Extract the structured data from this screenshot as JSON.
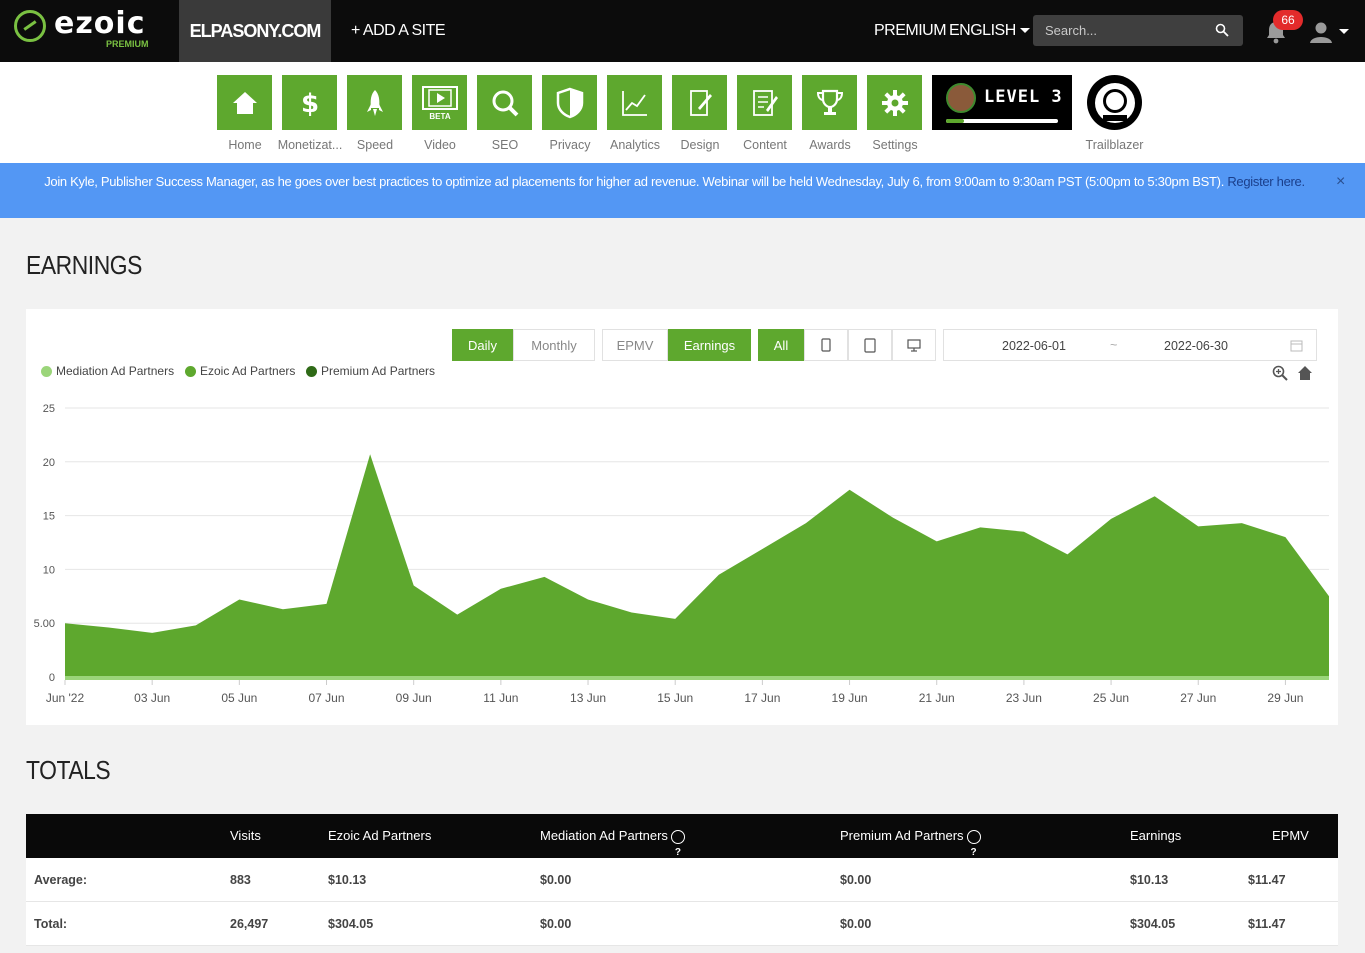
{
  "header": {
    "logo_text": "ezoic",
    "logo_sub": "PREMIUM",
    "site_name": "ELPASONY.COM",
    "add_site": "+ ADD A SITE",
    "premium": "PREMIUM",
    "language": "ENGLISH",
    "search_placeholder": "Search...",
    "notification_count": "66"
  },
  "nav": {
    "items": [
      {
        "label": "Home",
        "icon": "home-icon"
      },
      {
        "label": "Monetizat...",
        "icon": "dollar-icon"
      },
      {
        "label": "Speed",
        "icon": "rocket-icon"
      },
      {
        "label": "Video",
        "icon": "video-icon",
        "tag": "BETA"
      },
      {
        "label": "SEO",
        "icon": "magnifier-icon"
      },
      {
        "label": "Privacy",
        "icon": "shield-icon"
      },
      {
        "label": "Analytics",
        "icon": "line-chart-icon"
      },
      {
        "label": "Design",
        "icon": "design-icon"
      },
      {
        "label": "Content",
        "icon": "content-icon"
      },
      {
        "label": "Awards",
        "icon": "trophy-icon"
      },
      {
        "label": "Settings",
        "icon": "gear-icon"
      }
    ],
    "level_text": "LEVEL 3",
    "level_progress": 0.16,
    "trailblazer_label": "Trailblazer"
  },
  "announcement": {
    "text": "Join Kyle, Publisher Success Manager, as he goes over best practices to optimize ad placements for higher ad revenue. Webinar will be held Wednesday, July 6, from 9:00am to 9:30am PST (5:00pm to 5:30pm BST).",
    "link_text": "Register here.",
    "close": "×"
  },
  "earnings": {
    "title": "EARNINGS",
    "buttons": {
      "daily": "Daily",
      "monthly": "Monthly",
      "epmv": "EPMV",
      "earnings": "Earnings",
      "all": "All"
    },
    "date_start": "2022-06-01",
    "date_sep": "~",
    "date_end": "2022-06-30",
    "legend": [
      {
        "name": "Mediation Ad Partners",
        "color": "#9bd57a"
      },
      {
        "name": "Ezoic Ad Partners",
        "color": "#5ea82e"
      },
      {
        "name": "Premium Ad Partners",
        "color": "#2f6a17"
      }
    ]
  },
  "chart_data": {
    "type": "area",
    "x": [
      "2022-06-01",
      "2022-06-02",
      "2022-06-03",
      "2022-06-04",
      "2022-06-05",
      "2022-06-06",
      "2022-06-07",
      "2022-06-08",
      "2022-06-09",
      "2022-06-10",
      "2022-06-11",
      "2022-06-12",
      "2022-06-13",
      "2022-06-14",
      "2022-06-15",
      "2022-06-16",
      "2022-06-17",
      "2022-06-18",
      "2022-06-19",
      "2022-06-20",
      "2022-06-21",
      "2022-06-22",
      "2022-06-23",
      "2022-06-24",
      "2022-06-25",
      "2022-06-26",
      "2022-06-27",
      "2022-06-28",
      "2022-06-29",
      "2022-06-30"
    ],
    "x_tick_labels": [
      "Jun '22",
      "03 Jun",
      "05 Jun",
      "07 Jun",
      "09 Jun",
      "11 Jun",
      "13 Jun",
      "15 Jun",
      "17 Jun",
      "19 Jun",
      "21 Jun",
      "23 Jun",
      "25 Jun",
      "27 Jun",
      "29 Jun"
    ],
    "series": [
      {
        "name": "Ezoic Ad Partners",
        "color": "#5ea82e",
        "values": [
          5.0,
          4.6,
          4.1,
          4.8,
          7.2,
          6.3,
          6.8,
          20.7,
          8.5,
          5.8,
          8.2,
          9.3,
          7.2,
          6.0,
          5.4,
          9.5,
          11.9,
          14.3,
          17.4,
          14.8,
          12.6,
          13.9,
          13.5,
          11.4,
          14.7,
          16.8,
          14.0,
          14.3,
          13.0,
          7.5
        ]
      },
      {
        "name": "Mediation Ad Partners",
        "color": "#9bd57a",
        "values": [
          0,
          0,
          0,
          0,
          0,
          0,
          0,
          0,
          0,
          0,
          0,
          0,
          0,
          0,
          0,
          0,
          0,
          0,
          0,
          0,
          0,
          0,
          0,
          0,
          0,
          0,
          0,
          0,
          0,
          0
        ]
      },
      {
        "name": "Premium Ad Partners",
        "color": "#2f6a17",
        "values": [
          0,
          0,
          0,
          0,
          0,
          0,
          0,
          0,
          0,
          0,
          0,
          0,
          0,
          0,
          0,
          0,
          0,
          0,
          0,
          0,
          0,
          0,
          0,
          0,
          0,
          0,
          0,
          0,
          0,
          0
        ]
      }
    ],
    "y_tick_labels": [
      "0",
      "5.00",
      "10",
      "15",
      "20",
      "25"
    ],
    "ylim": [
      0,
      25
    ],
    "grid": true,
    "legend_position": "top-left"
  },
  "totals": {
    "title": "TOTALS",
    "headers": [
      "",
      "Visits",
      "Ezoic Ad Partners",
      "Mediation Ad Partners",
      "Premium Ad Partners",
      "Earnings",
      "EPMV"
    ],
    "rows": [
      [
        "Average:",
        "883",
        "$10.13",
        "$0.00",
        "$0.00",
        "$10.13",
        "$11.47"
      ],
      [
        "Total:",
        "26,497",
        "$304.05",
        "$0.00",
        "$0.00",
        "$304.05",
        "$11.47"
      ]
    ]
  }
}
